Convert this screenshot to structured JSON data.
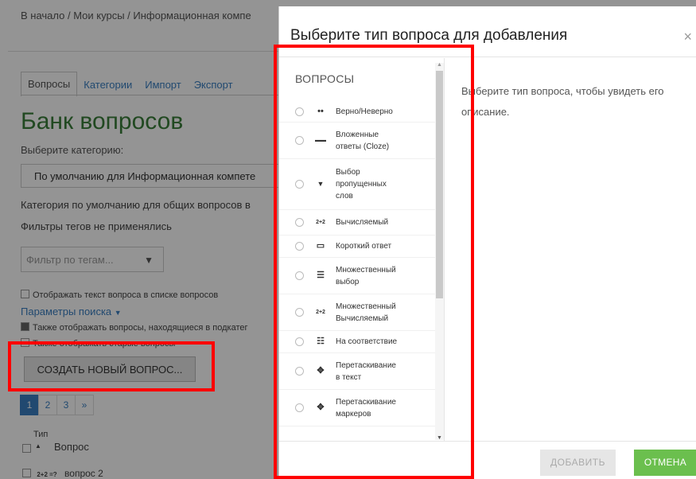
{
  "breadcrumb": "В начало / Мои курсы / Информационная компе",
  "tabs": [
    "Вопросы",
    "Категории",
    "Импорт",
    "Экспорт"
  ],
  "page": {
    "title": "Банк вопросов",
    "category_label": "Выберите категорию:",
    "category_value": "По умолчанию для Информационная компете",
    "default_category_text": "Категория по умолчанию для общих вопросов в",
    "tag_filters_text": "Фильтры тегов не применялись",
    "tag_filter_placeholder": "Фильтр по тегам...",
    "show_text_checkbox": "Отображать текст вопроса в списке вопросов",
    "search_params": "Параметры поиска",
    "subcategory_checkbox": "Также отображать вопросы, находящиеся в подкатег",
    "old_questions_checkbox": "Также отображать старые вопросы",
    "create_button": "СОЗДАТЬ НОВЫЙ ВОПРОС...",
    "pagination": [
      "1",
      "2",
      "3",
      "»"
    ],
    "table_head_type": "Тип",
    "table_head_question": "Вопрос",
    "row_icon": "2+2 =?",
    "row_text": "вопрос 2"
  },
  "modal": {
    "title": "Выберите тип вопроса для добавления",
    "close": "×",
    "section": "ВОПРОСЫ",
    "description": "Выберите тип вопроса, чтобы увидеть его описание.",
    "add_button": "ДОБАВИТЬ",
    "cancel_button": "ОТМЕНА",
    "question_types": [
      {
        "label": "Верно/Неверно",
        "icon": "••"
      },
      {
        "label": "Вложенные ответы (Cloze)",
        "icon": "▬▬"
      },
      {
        "label": "Выбор пропущенных слов",
        "icon": "▼"
      },
      {
        "label": "Вычисляемый",
        "icon": "2+2"
      },
      {
        "label": "Короткий ответ",
        "icon": "▭"
      },
      {
        "label": "Множественный выбор",
        "icon": "☰"
      },
      {
        "label": "Множественный Вычисляемый",
        "icon": "2+2"
      },
      {
        "label": "На соответствие",
        "icon": "☷"
      },
      {
        "label": "Перетаскивание в текст",
        "icon": "✥"
      },
      {
        "label": "Перетаскивание маркеров",
        "icon": "✥"
      }
    ]
  },
  "colors": {
    "highlight": "#ff0000",
    "cancel_button": "#6bbf4e",
    "title_green": "#3a7f3a",
    "link_blue": "#3a7fc1"
  }
}
